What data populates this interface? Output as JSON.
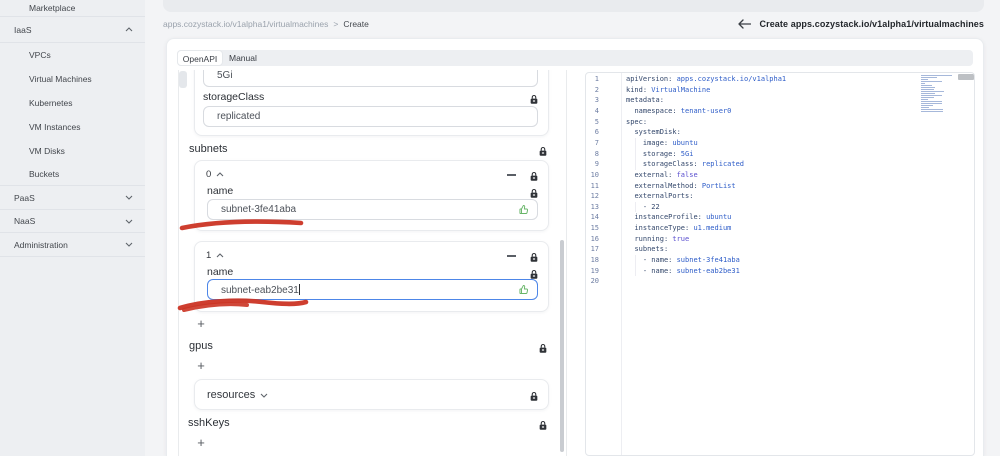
{
  "sidebar": {
    "items": [
      {
        "label": "Marketplace",
        "type": "sub",
        "chevron": "none",
        "divider": true
      },
      {
        "label": "IaaS",
        "type": "group",
        "chevron": "up",
        "divider": true
      },
      {
        "label": "VPCs",
        "type": "sub",
        "chevron": "none",
        "divider": false
      },
      {
        "label": "Virtual Machines",
        "type": "sub",
        "chevron": "none",
        "divider": false
      },
      {
        "label": "Kubernetes",
        "type": "sub",
        "chevron": "none",
        "divider": false
      },
      {
        "label": "VM Instances",
        "type": "sub",
        "chevron": "none",
        "divider": false
      },
      {
        "label": "VM Disks",
        "type": "sub",
        "chevron": "none",
        "divider": false
      },
      {
        "label": "Buckets",
        "type": "sub",
        "chevron": "none",
        "divider": true
      },
      {
        "label": "PaaS",
        "type": "group",
        "chevron": "down",
        "divider": true
      },
      {
        "label": "NaaS",
        "type": "group",
        "chevron": "down",
        "divider": true
      },
      {
        "label": "Administration",
        "type": "group",
        "chevron": "down",
        "divider": true
      }
    ]
  },
  "breadcrumb": {
    "path": "apps.cozystack.io/v1alpha1/virtualmachines",
    "separator": ">",
    "current": "Create"
  },
  "header": {
    "title": "Create apps.cozystack.io/v1alpha1/virtualmachines"
  },
  "tabs": [
    {
      "label": "OpenAPI",
      "active": true
    },
    {
      "label": "Manual",
      "active": false
    }
  ],
  "form": {
    "add_label": "+",
    "system_disk": {
      "top_field_value": "5Gi",
      "storage_class_label": "storageClass",
      "storage_class_value": "replicated"
    },
    "subnets": {
      "label": "subnets",
      "items": [
        {
          "index": "0",
          "field_label": "name",
          "value": "subnet-3fe41aba",
          "focused": false
        },
        {
          "index": "1",
          "field_label": "name",
          "value": "subnet-eab2be31",
          "focused": true
        }
      ]
    },
    "gpus_label": "gpus",
    "resources_label": "resources",
    "ssh_keys_label": "sshKeys"
  },
  "editor": {
    "language": "yaml",
    "lines": [
      [
        [
          "k",
          "apiVersion:"
        ],
        [
          "v",
          " apps.cozystack.io/v1alpha1"
        ]
      ],
      [
        [
          "k",
          "kind:"
        ],
        [
          "v",
          " VirtualMachine"
        ]
      ],
      [
        [
          "k",
          "metadata:"
        ]
      ],
      [
        [
          "d",
          "  "
        ],
        [
          "k",
          "namespace:"
        ],
        [
          "v",
          " tenant-user0"
        ]
      ],
      [
        [
          "k",
          "spec:"
        ]
      ],
      [
        [
          "d",
          "  "
        ],
        [
          "k",
          "systemDisk:"
        ]
      ],
      [
        [
          "d",
          "    "
        ],
        [
          "k",
          "image:"
        ],
        [
          "v",
          " ubuntu"
        ]
      ],
      [
        [
          "d",
          "    "
        ],
        [
          "k",
          "storage:"
        ],
        [
          "v",
          " 5Gi"
        ]
      ],
      [
        [
          "d",
          "    "
        ],
        [
          "k",
          "storageClass:"
        ],
        [
          "v",
          " replicated"
        ]
      ],
      [
        [
          "d",
          "  "
        ],
        [
          "k",
          "external:"
        ],
        [
          "b",
          " false"
        ]
      ],
      [
        [
          "d",
          "  "
        ],
        [
          "k",
          "externalMethod:"
        ],
        [
          "v",
          " PortList"
        ]
      ],
      [
        [
          "d",
          "  "
        ],
        [
          "k",
          "externalPorts:"
        ]
      ],
      [
        [
          "d",
          "    - "
        ],
        [
          "n",
          "22"
        ]
      ],
      [
        [
          "d",
          "  "
        ],
        [
          "k",
          "instanceProfile:"
        ],
        [
          "v",
          " ubuntu"
        ]
      ],
      [
        [
          "d",
          "  "
        ],
        [
          "k",
          "instanceType:"
        ],
        [
          "v",
          " u1.medium"
        ]
      ],
      [
        [
          "d",
          "  "
        ],
        [
          "k",
          "running:"
        ],
        [
          "b",
          " true"
        ]
      ],
      [
        [
          "d",
          "  "
        ],
        [
          "k",
          "subnets:"
        ]
      ],
      [
        [
          "d",
          "    - "
        ],
        [
          "k",
          "name:"
        ],
        [
          "v",
          " subnet-3fe41aba"
        ]
      ],
      [
        [
          "d",
          "    - "
        ],
        [
          "k",
          "name:"
        ],
        [
          "v",
          " subnet-eab2be31"
        ]
      ],
      []
    ]
  },
  "annotations": {
    "color": "#cb3424",
    "items": [
      "underline-subnet-0",
      "underline-subnet-1"
    ]
  }
}
